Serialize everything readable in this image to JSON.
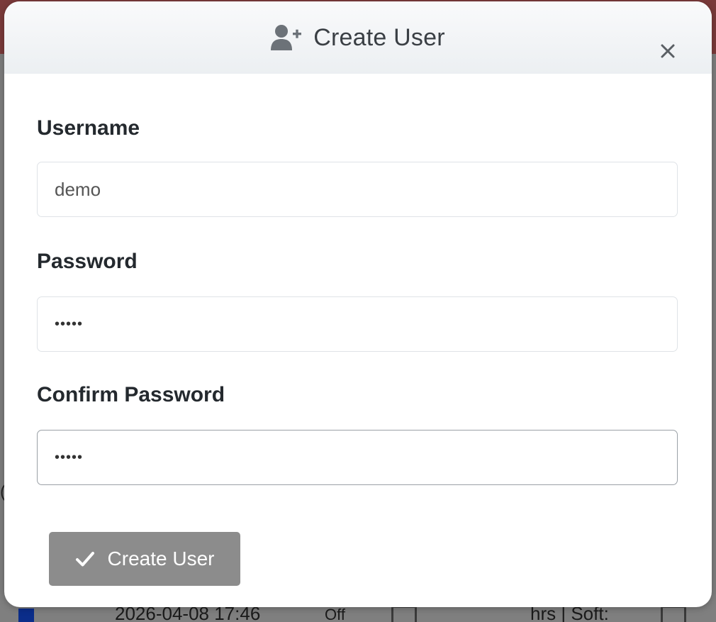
{
  "background": {
    "row": {
      "timestamp": "2026-04-08 17:46",
      "status": "Off",
      "note": "hrs | Soft:"
    }
  },
  "modal": {
    "title": "Create User",
    "title_icon": "user-plus-icon",
    "close_icon": "close-icon",
    "fields": [
      {
        "label": "Username",
        "value": "demo",
        "type": "text"
      },
      {
        "label": "Password",
        "value": "•••••",
        "type": "password"
      },
      {
        "label": "Confirm Password",
        "value": "•••••",
        "type": "password"
      }
    ],
    "submit": {
      "label": "Create User",
      "icon": "checkmark-icon",
      "color": "#8c8c8c"
    }
  }
}
